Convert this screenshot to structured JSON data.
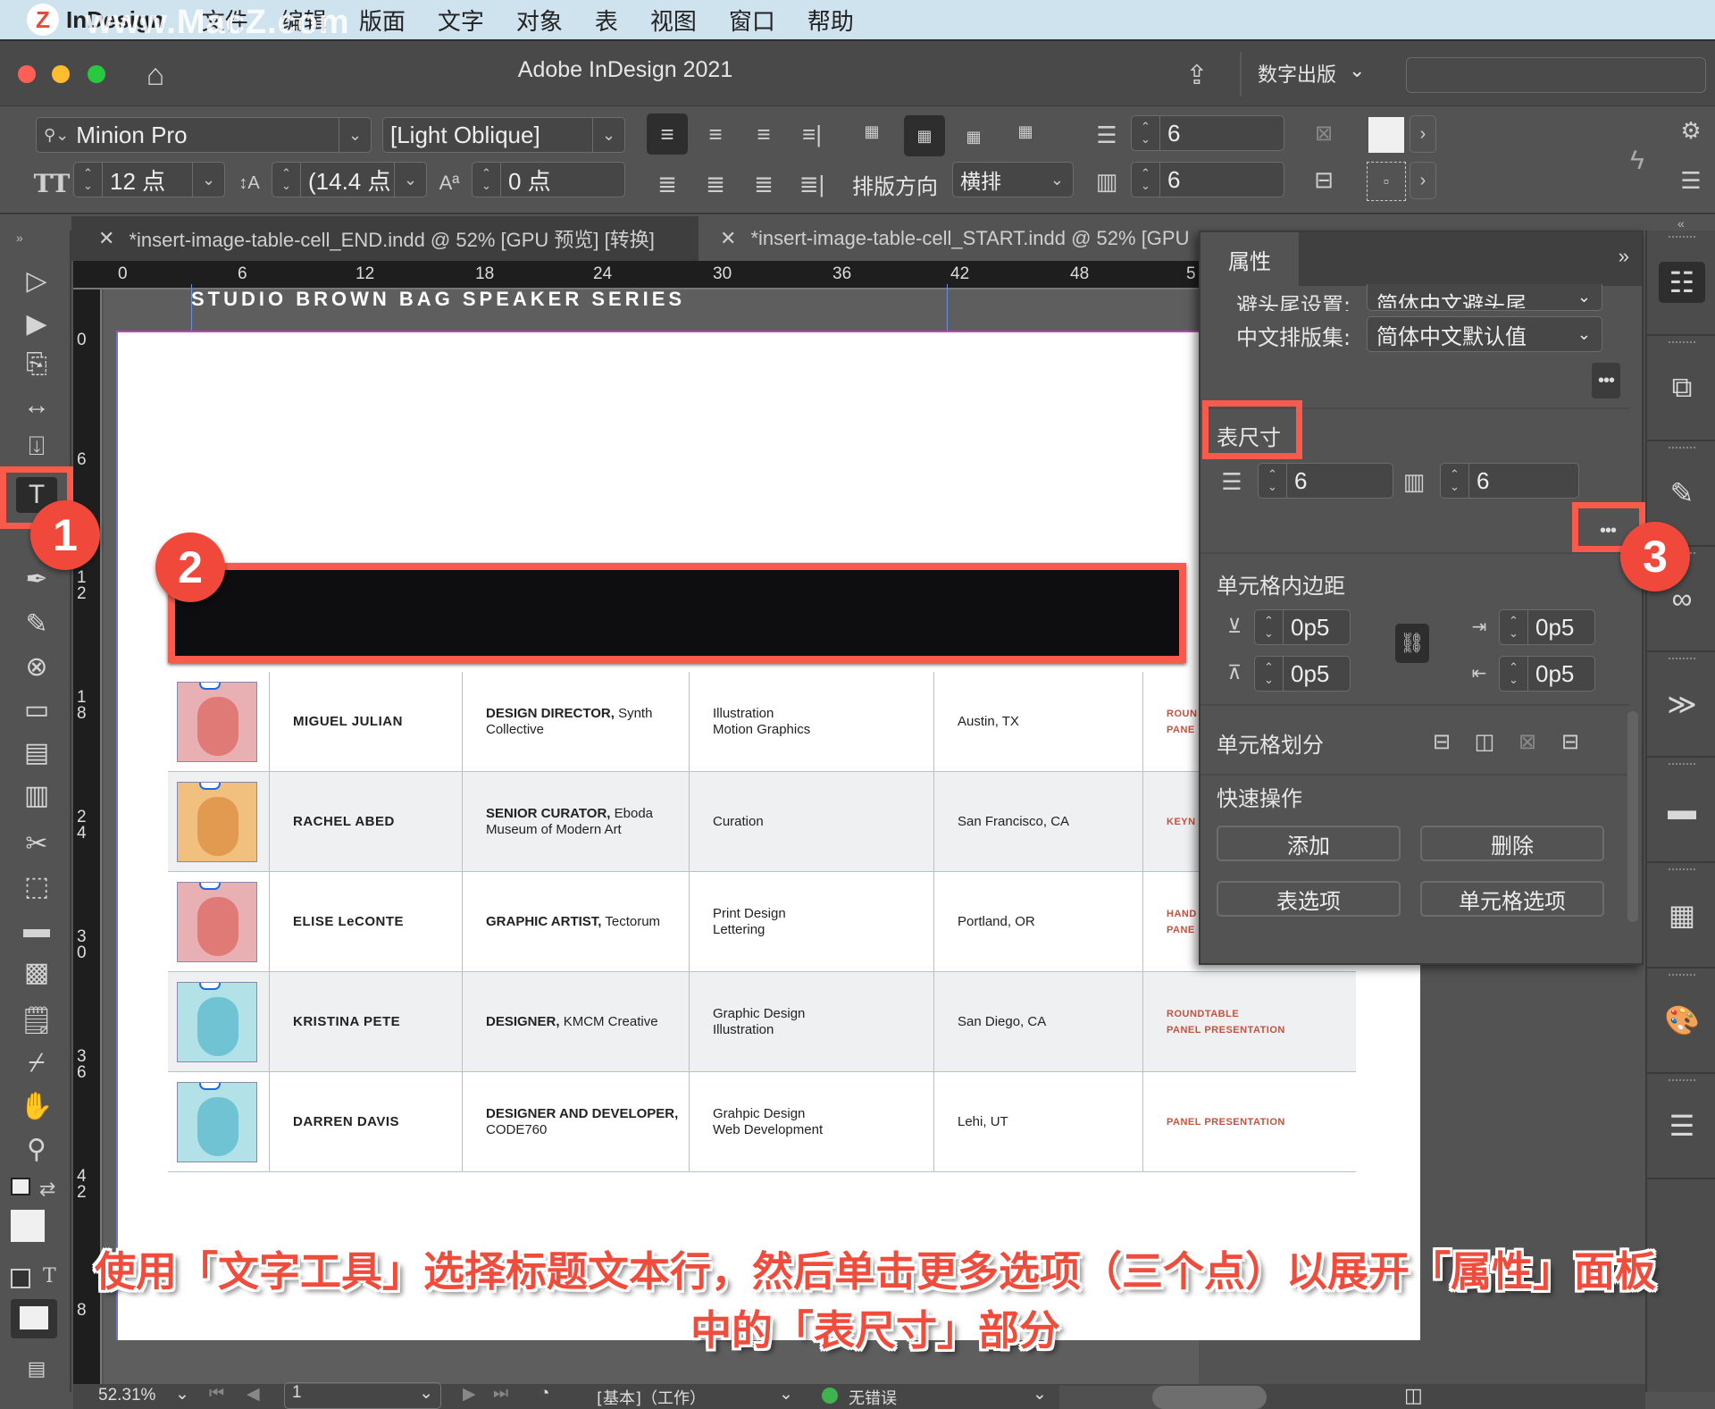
{
  "menubar": {
    "app": "InDesign",
    "watermark": "www.MacZ.com",
    "logo": "Z",
    "items": [
      "文件",
      "编辑",
      "版面",
      "文字",
      "对象",
      "表",
      "视图",
      "窗口",
      "帮助"
    ]
  },
  "titlebar": {
    "title": "Adobe InDesign 2021",
    "workspace": "数字出版",
    "search_placeholder": ""
  },
  "control_panel": {
    "font_family": "Minion Pro",
    "font_style": "[Light Oblique]",
    "font_size": "12 点",
    "leading": "(14.4 点",
    "baseline_shift": "0 点",
    "composition_label": "排版方向",
    "composition_value": "横排",
    "rows": "6",
    "columns": "6"
  },
  "tabs": [
    {
      "label": "*insert-image-table-cell_END.indd @ 52% [GPU 预览] [转换]",
      "active": false
    },
    {
      "label": "*insert-image-table-cell_START.indd @ 52% [GPU",
      "active": true
    }
  ],
  "rulers": {
    "horizontal": [
      "0",
      "6",
      "12",
      "18",
      "24",
      "30",
      "36",
      "42",
      "48",
      "5"
    ],
    "vertical": [
      "0",
      "6",
      "1\n2",
      "1\n8",
      "2\n4",
      "3\n0",
      "3\n6",
      "4\n2",
      "8"
    ]
  },
  "document": {
    "banner": "STUDIO BROWN BAG SPEAKER SERIES",
    "table_rows": [
      {
        "name": "MIGUEL JULIAN",
        "title_bold": "DESIGN DIRECTOR,",
        "title_rest": "Synth Collective",
        "skills": [
          "Illustration",
          "Motion Graphics"
        ],
        "location": "Austin, TX",
        "event": [
          "ROUN",
          "PANE"
        ],
        "avatar_bg": "#e9b0b4",
        "face": "#e07a77"
      },
      {
        "name": "RACHEL ABED",
        "title_bold": "SENIOR CURATOR,",
        "title_rest": "Eboda Museum of Modern Art",
        "skills": [
          "Curation"
        ],
        "location": "San Francisco, CA",
        "event": [
          "KEYN"
        ],
        "avatar_bg": "#f2c07e",
        "face": "#e29a50"
      },
      {
        "name": "ELISE LeCONTE",
        "title_bold": "GRAPHIC ARTIST,",
        "title_rest": "Tectorum",
        "skills": [
          "Print Design",
          "Lettering"
        ],
        "location": "Portland, OR",
        "event": [
          "HAND",
          "PANE"
        ],
        "avatar_bg": "#e9b0b4",
        "face": "#e07a77"
      },
      {
        "name": "KRISTINA PETE",
        "title_bold": "DESIGNER,",
        "title_rest": "KMCM Creative",
        "skills": [
          "Graphic Design",
          "Illustration"
        ],
        "location": "San Diego, CA",
        "event": [
          "ROUNDTABLE",
          "PANEL PRESENTATION"
        ],
        "avatar_bg": "#b2e2e8",
        "face": "#6fc3d2"
      },
      {
        "name": "DARREN DAVIS",
        "title_bold": "DESIGNER AND DEVELOPER,",
        "title_rest": "CODE760",
        "skills": [
          "Grahpic Design",
          "Web Development"
        ],
        "location": "Lehi, UT",
        "event": [
          "PANEL PRESENTATION"
        ],
        "avatar_bg": "#b2e2e8",
        "face": "#6fc3d2"
      }
    ]
  },
  "properties_panel": {
    "tab": "属性",
    "kinsoku_label": "避头尾设置:",
    "kinsoku_value": "简体中文避头尾",
    "mojikumi_label": "中文排版集:",
    "mojikumi_value": "简体中文默认值",
    "table_size_label": "表尺寸",
    "rows": "6",
    "columns": "6",
    "cell_inset_label": "单元格内边距",
    "inset_top": "0p5",
    "inset_bottom": "0p5",
    "inset_left": "0p5",
    "inset_right": "0p5",
    "cell_split_label": "单元格划分",
    "quick_actions_label": "快速操作",
    "btn_add": "添加",
    "btn_delete": "删除",
    "btn_table_options": "表选项",
    "btn_cell_options": "单元格选项"
  },
  "status_bar": {
    "zoom": "52.31%",
    "page": "1",
    "preflight_profile": "[基本]（工作）",
    "errors": "无错误",
    "status_color": "#3fb34f"
  },
  "callouts": [
    "1",
    "2",
    "3"
  ],
  "caption": {
    "line1": "使用「文字工具」选择标题文本行，然后单击更多选项（三个点）以展开「属性」面板",
    "line2": "中的「表尺寸」部分"
  },
  "colors": {
    "highlight": "#fa5a4b",
    "accent": "#1c6ee0"
  }
}
